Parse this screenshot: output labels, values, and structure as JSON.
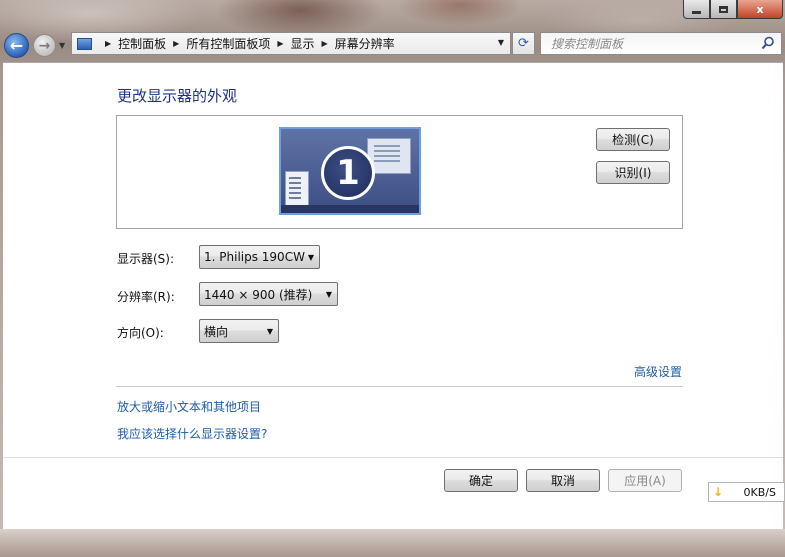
{
  "window": {
    "caption_minimize": "",
    "caption_maximize": "",
    "caption_close": "x"
  },
  "nav": {
    "back_glyph": "←",
    "forward_glyph": "→",
    "breadcrumbs": [
      "控制面板",
      "所有控制面板项",
      "显示",
      "屏幕分辨率"
    ],
    "refresh_glyph": "⟳"
  },
  "search": {
    "placeholder": "搜索控制面板"
  },
  "page": {
    "heading": "更改显示器的外观",
    "monitor_number": "1",
    "detect_button": "检测(C)",
    "identify_button": "识别(I)",
    "display_label": "显示器(S):",
    "display_value": "1. Philips 190CW",
    "resolution_label": "分辨率(R):",
    "resolution_value": "1440 × 900 (推荐)",
    "orientation_label": "方向(O):",
    "orientation_value": "横向",
    "advanced_link": "高级设置",
    "text_size_link": "放大或缩小文本和其他项目",
    "which_settings_link": "我应该选择什么显示器设置?"
  },
  "footer": {
    "ok_button": "确定",
    "cancel_button": "取消",
    "apply_button": "应用(A)"
  },
  "speed_widget": {
    "value": "0KB/S"
  },
  "colors": {
    "heading": "#1e3287",
    "link": "#1e5ca8",
    "monitor_border": "#6aa0e0"
  }
}
